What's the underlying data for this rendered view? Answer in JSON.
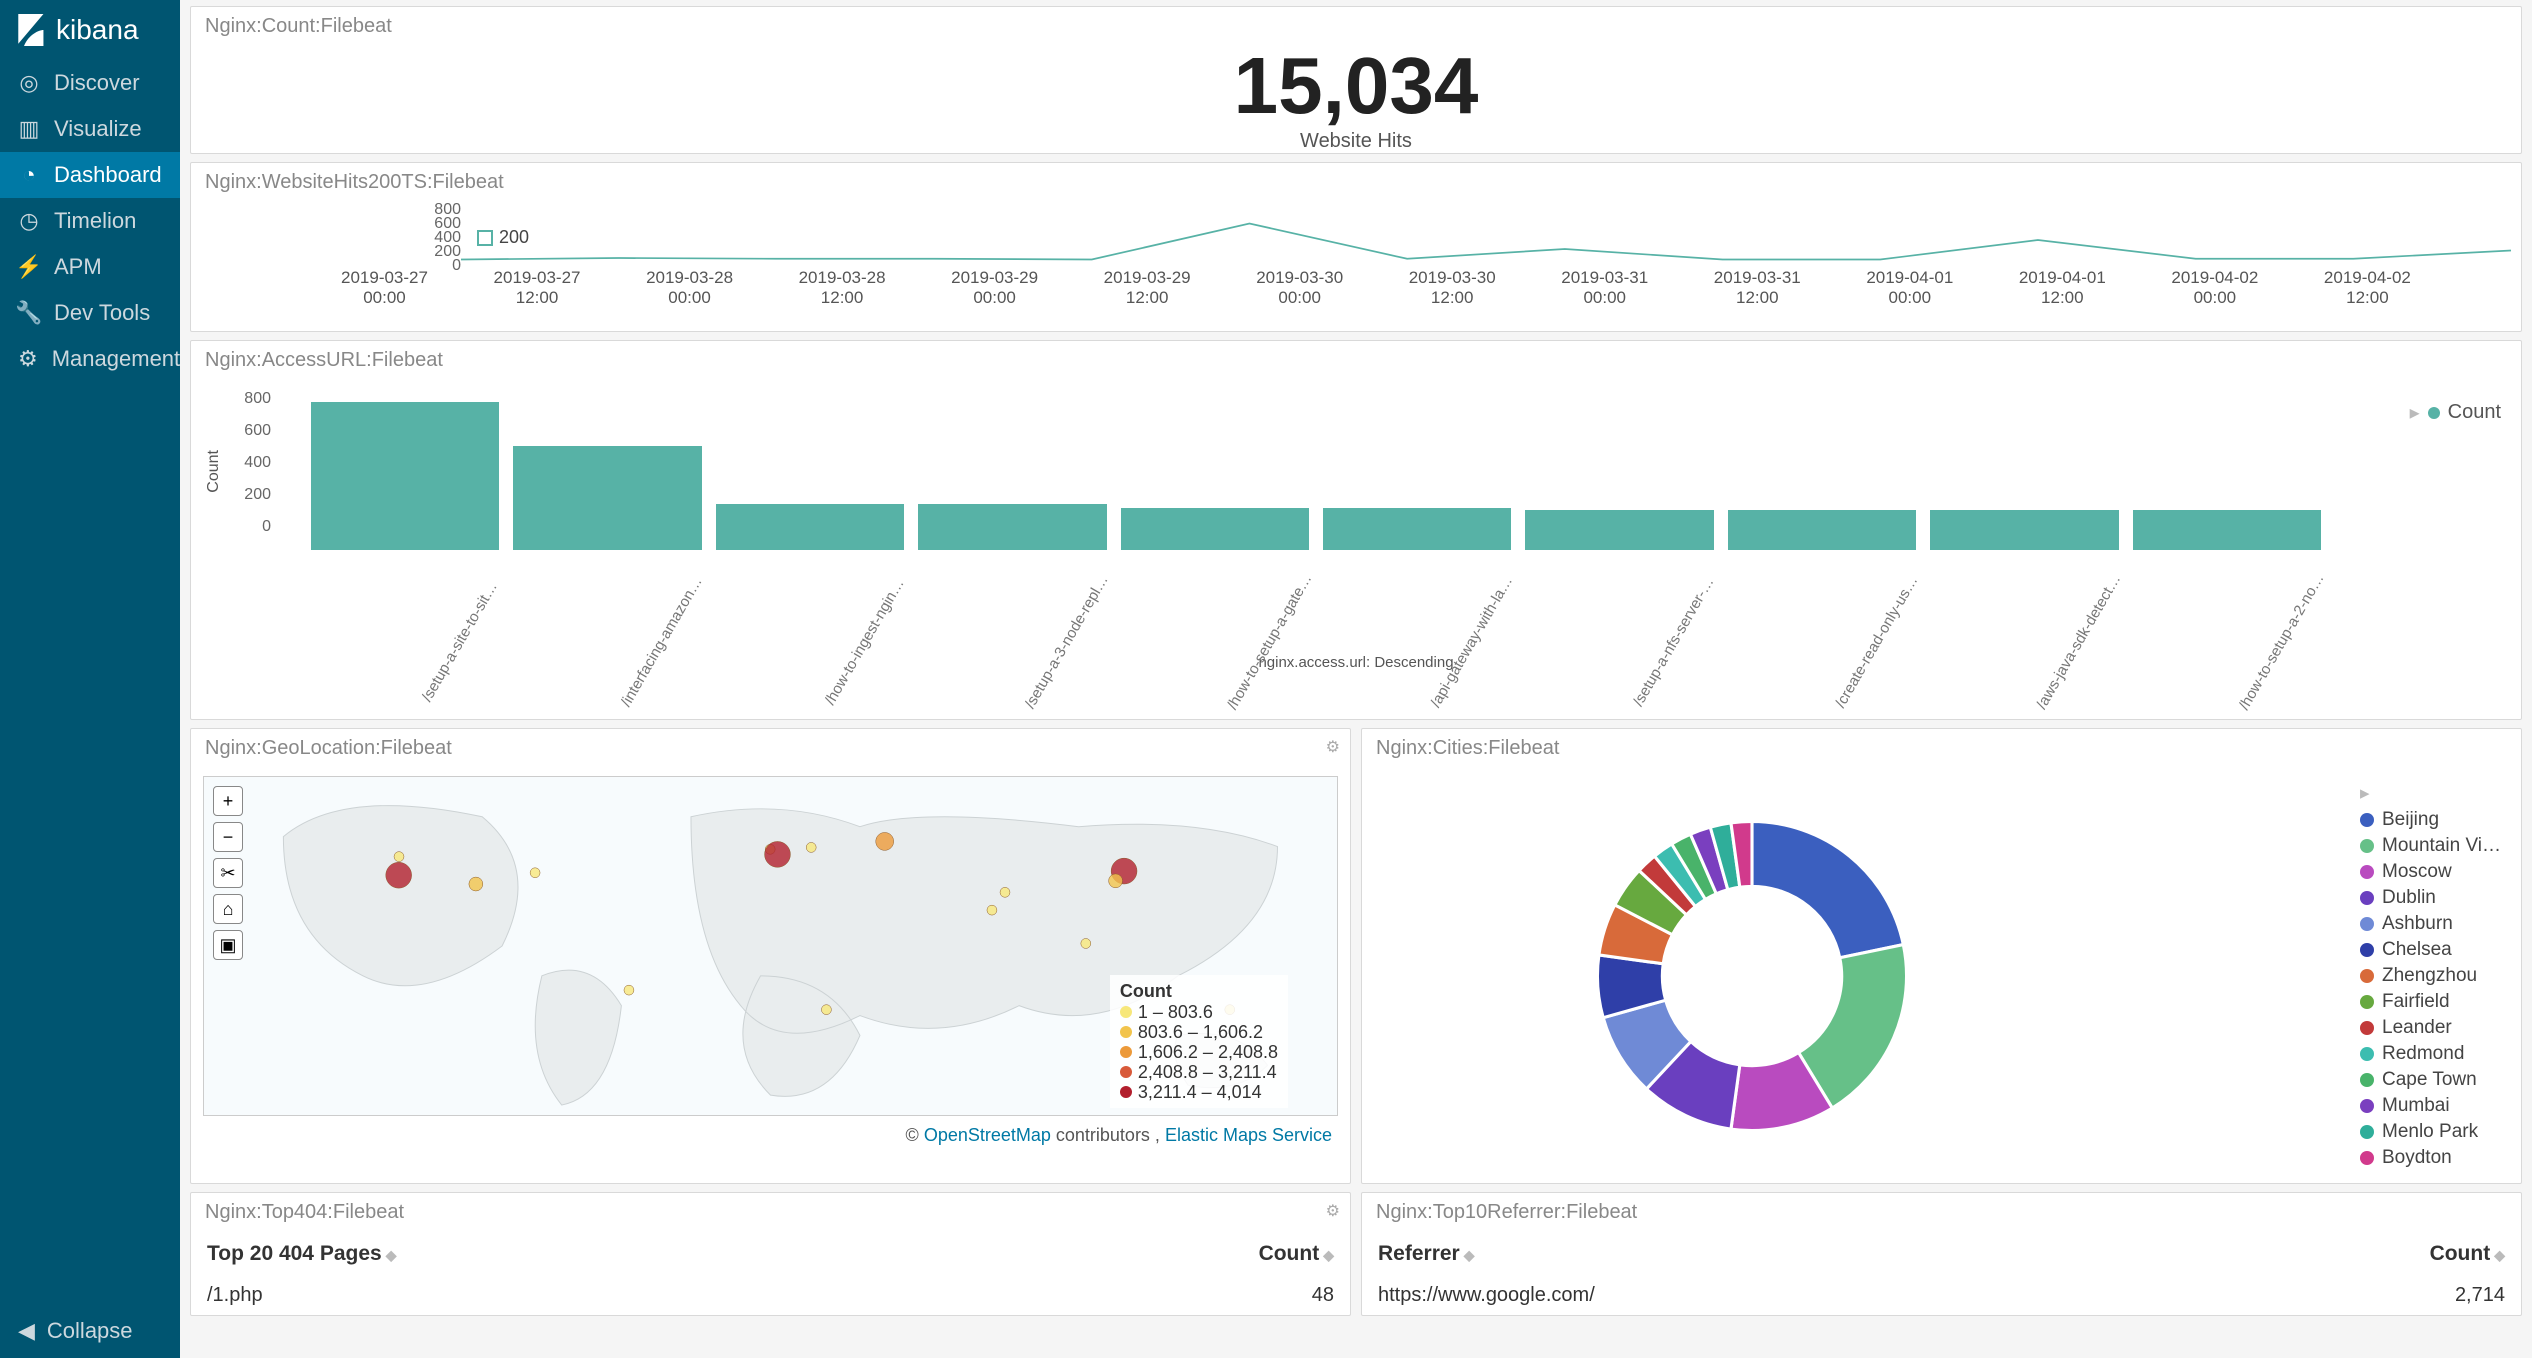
{
  "brand": "kibana",
  "sidebar": {
    "items": [
      {
        "label": "Discover",
        "icon": "compass-icon"
      },
      {
        "label": "Visualize",
        "icon": "bar-chart-icon"
      },
      {
        "label": "Dashboard",
        "icon": "pie-slice-icon",
        "active": true
      },
      {
        "label": "Timelion",
        "icon": "clock-icon"
      },
      {
        "label": "APM",
        "icon": "bolt-icon"
      },
      {
        "label": "Dev Tools",
        "icon": "wrench-icon"
      },
      {
        "label": "Management",
        "icon": "gear-icon"
      }
    ],
    "collapse": "Collapse"
  },
  "panels": {
    "metric": {
      "title": "Nginx:Count:Filebeat",
      "value": "15,034",
      "sub": "Website Hits"
    },
    "ts": {
      "title": "Nginx:WebsiteHits200TS:Filebeat",
      "yticks": [
        "800",
        "600",
        "400",
        "200",
        "0"
      ],
      "legend": "200",
      "xticks": [
        "2019-03-27\n00:00",
        "2019-03-27\n12:00",
        "2019-03-28\n00:00",
        "2019-03-28\n12:00",
        "2019-03-29\n00:00",
        "2019-03-29\n12:00",
        "2019-03-30\n00:00",
        "2019-03-30\n12:00",
        "2019-03-31\n00:00",
        "2019-03-31\n12:00",
        "2019-04-01\n00:00",
        "2019-04-01\n12:00",
        "2019-04-02\n00:00",
        "2019-04-02\n12:00"
      ]
    },
    "bars": {
      "title": "Nginx:AccessURL:Filebeat",
      "ylabel": "Count",
      "yticks": [
        "800",
        "600",
        "400",
        "200",
        "0"
      ],
      "legend": "Count",
      "xaxis_title": "nginx.access.url: Descending"
    },
    "geo": {
      "title": "Nginx:GeoLocation:Filebeat",
      "legend_title": "Count",
      "legend": [
        {
          "color": "#f7e77a",
          "label": "1 – 803.6"
        },
        {
          "color": "#f2c44c",
          "label": "803.6 – 1,606.2"
        },
        {
          "color": "#ec9a3a",
          "label": "1,606.2 – 2,408.8"
        },
        {
          "color": "#d85a3a",
          "label": "2,408.8 – 3,211.4"
        },
        {
          "color": "#b21f2d",
          "label": "3,211.4 – 4,014"
        }
      ],
      "attr_prefix": "© ",
      "attr_osm": "OpenStreetMap",
      "attr_mid": " contributors , ",
      "attr_ems": "Elastic Maps Service"
    },
    "cities": {
      "title": "Nginx:Cities:Filebeat"
    },
    "top404": {
      "title": "Nginx:Top404:Filebeat",
      "col1": "Top 20 404 Pages",
      "col2": "Count",
      "rows": [
        {
          "page": "/1.php",
          "count": "48"
        }
      ]
    },
    "referrer": {
      "title": "Nginx:Top10Referrer:Filebeat",
      "col1": "Referrer",
      "col2": "Count",
      "rows": [
        {
          "ref": "https://www.google.com/",
          "count": "2,714"
        }
      ]
    }
  },
  "chart_data": [
    {
      "id": "website_hits_timeseries",
      "type": "line",
      "title": "Nginx:WebsiteHits200TS:Filebeat",
      "ylabel": "",
      "xlabel": "",
      "ylim": [
        0,
        800
      ],
      "series": [
        {
          "name": "200",
          "color": "#57b2a6",
          "x": [
            "2019-03-27 00:00",
            "2019-03-27 12:00",
            "2019-03-28 00:00",
            "2019-03-28 12:00",
            "2019-03-29 00:00",
            "2019-03-29 12:00",
            "2019-03-30 00:00",
            "2019-03-30 12:00",
            "2019-03-31 00:00",
            "2019-03-31 12:00",
            "2019-04-01 00:00",
            "2019-04-01 12:00",
            "2019-04-02 00:00",
            "2019-04-02 12:00"
          ],
          "values": [
            60,
            80,
            70,
            70,
            60,
            540,
            70,
            200,
            60,
            60,
            320,
            70,
            70,
            180
          ]
        }
      ]
    },
    {
      "id": "access_url_bars",
      "type": "bar",
      "title": "Nginx:AccessURL:Filebeat",
      "ylabel": "Count",
      "xlabel": "nginx.access.url: Descending",
      "ylim": [
        0,
        800
      ],
      "categories": [
        "/setup-a-site-to-sit…",
        "/interfacing-amazon…",
        "/how-to-ingest-ngin…",
        "/setup-a-3-node-repl…",
        "/how-to-setup-a-gate…",
        "/api-gateway-with-la…",
        "/setup-a-nfs-server-…",
        "/create-read-only-us…",
        "/aws-java-sdk-detect…",
        "/how-to-setup-a-2-no…"
      ],
      "values": [
        740,
        520,
        230,
        230,
        210,
        210,
        200,
        200,
        200,
        200
      ],
      "series_name": "Count",
      "color": "#57b2a6"
    },
    {
      "id": "cities_donut",
      "type": "pie",
      "title": "Nginx:Cities:Filebeat",
      "series": [
        {
          "name": "Beijing",
          "color": "#3b5fbf",
          "value": 20
        },
        {
          "name": "Mountain Vi…",
          "color": "#66c088",
          "value": 18
        },
        {
          "name": "Moscow",
          "color": "#b94bbf",
          "value": 10
        },
        {
          "name": "Dublin",
          "color": "#6a3fbf",
          "value": 9
        },
        {
          "name": "Ashburn",
          "color": "#6f8ad6",
          "value": 8
        },
        {
          "name": "Chelsea",
          "color": "#2f3fa8",
          "value": 6
        },
        {
          "name": "Zhengzhou",
          "color": "#d86a3a",
          "value": 5
        },
        {
          "name": "Fairfield",
          "color": "#67a93f",
          "value": 4
        },
        {
          "name": "Leander",
          "color": "#c23a3a",
          "value": 2
        },
        {
          "name": "Redmond",
          "color": "#3cbdb0",
          "value": 2
        },
        {
          "name": "Cape Town",
          "color": "#49b36a",
          "value": 2
        },
        {
          "name": "Mumbai",
          "color": "#7a3fbf",
          "value": 2
        },
        {
          "name": "Menlo Park",
          "color": "#2fae9a",
          "value": 2
        },
        {
          "name": "Boydton",
          "color": "#d13a8c",
          "value": 2
        }
      ]
    },
    {
      "id": "geo_bubbles",
      "type": "scatter",
      "title": "Nginx:GeoLocation:Filebeat",
      "legend_title": "Count",
      "bins": [
        {
          "color": "#f7e77a",
          "range": [
            1,
            803.6
          ]
        },
        {
          "color": "#f2c44c",
          "range": [
            803.6,
            1606.2
          ]
        },
        {
          "color": "#ec9a3a",
          "range": [
            1606.2,
            2408.8
          ]
        },
        {
          "color": "#d85a3a",
          "range": [
            2408.8,
            3211.4
          ]
        },
        {
          "color": "#b21f2d",
          "range": [
            3211.4,
            4014
          ]
        }
      ],
      "points": [
        {
          "lat": 37.7,
          "lon": -122.4,
          "bin": 4
        },
        {
          "lat": 33.0,
          "lon": -97.0,
          "bin": 1
        },
        {
          "lat": 47.6,
          "lon": -122.3,
          "bin": 0
        },
        {
          "lat": 39.0,
          "lon": -77.5,
          "bin": 0
        },
        {
          "lat": 51.5,
          "lon": -0.1,
          "bin": 0
        },
        {
          "lat": 48.8,
          "lon": 2.3,
          "bin": 4
        },
        {
          "lat": 52.5,
          "lon": 13.4,
          "bin": 0
        },
        {
          "lat": 55.7,
          "lon": 37.6,
          "bin": 2
        },
        {
          "lat": 39.9,
          "lon": 116.4,
          "bin": 4
        },
        {
          "lat": 34.7,
          "lon": 113.6,
          "bin": 1
        },
        {
          "lat": 28.6,
          "lon": 77.2,
          "bin": 0
        },
        {
          "lat": 19.1,
          "lon": 72.9,
          "bin": 0
        },
        {
          "lat": 1.35,
          "lon": 103.8,
          "bin": 0
        },
        {
          "lat": -33.9,
          "lon": 18.4,
          "bin": 0
        },
        {
          "lat": -23.5,
          "lon": -46.6,
          "bin": 0
        },
        {
          "lat": -33.9,
          "lon": 151.2,
          "bin": 0
        }
      ]
    },
    {
      "id": "top404_table",
      "type": "table",
      "title": "Nginx:Top404:Filebeat",
      "columns": [
        "Top 20 404 Pages",
        "Count"
      ],
      "rows": [
        [
          "/1.php",
          48
        ]
      ]
    },
    {
      "id": "referrer_table",
      "type": "table",
      "title": "Nginx:Top10Referrer:Filebeat",
      "columns": [
        "Referrer",
        "Count"
      ],
      "rows": [
        [
          "https://www.google.com/",
          2714
        ]
      ]
    }
  ]
}
